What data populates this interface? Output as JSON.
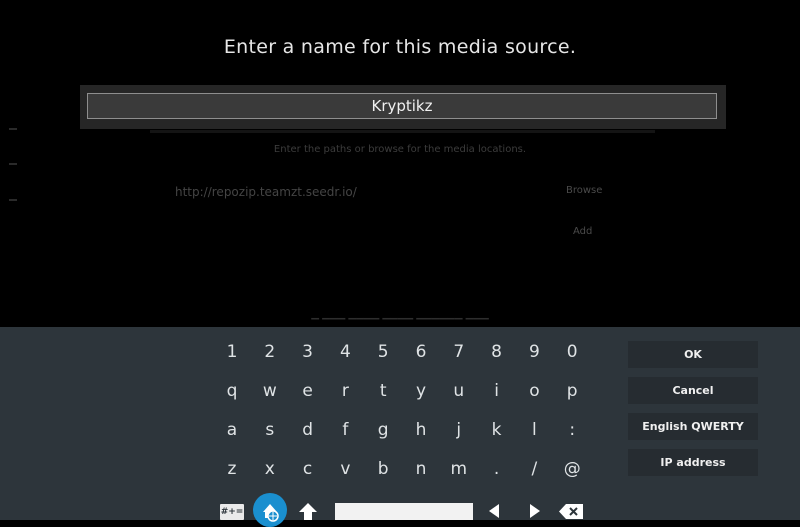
{
  "dialog": {
    "title": "Enter a name for this media source.",
    "input_value": "Kryptikz"
  },
  "background": {
    "hint": "Enter the paths or browse for the media locations.",
    "path": "http://repozip.teamzt.seedr.io/",
    "browse": "Browse",
    "add": "Add"
  },
  "keyboard": {
    "row1": [
      "1",
      "2",
      "3",
      "4",
      "5",
      "6",
      "7",
      "8",
      "9",
      "0"
    ],
    "row2": [
      "q",
      "w",
      "e",
      "r",
      "t",
      "y",
      "u",
      "i",
      "o",
      "p"
    ],
    "row3": [
      "a",
      "s",
      "d",
      "f",
      "g",
      "h",
      "j",
      "k",
      "l",
      ":"
    ],
    "row4": [
      "z",
      "x",
      "c",
      "v",
      "b",
      "n",
      "m",
      ".",
      "/",
      "@"
    ],
    "symbols_label": "#+=",
    "buttons": {
      "ok": "OK",
      "cancel": "Cancel",
      "layout": "English QWERTY",
      "ip": "IP address"
    },
    "icons": [
      "globe-icon",
      "shift-icon",
      "left-arrow-icon",
      "right-arrow-icon",
      "backspace-icon"
    ]
  }
}
